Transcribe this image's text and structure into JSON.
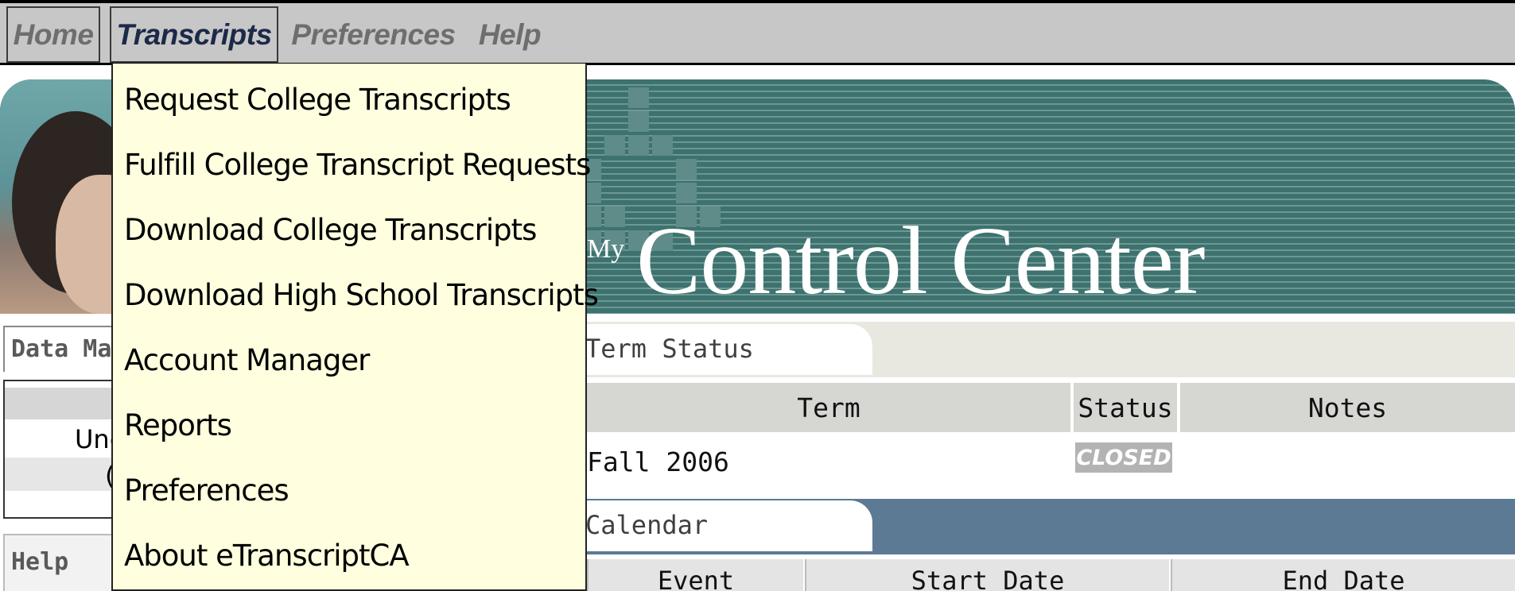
{
  "menubar": {
    "items": [
      {
        "label": "Home"
      },
      {
        "label": "Transcripts"
      },
      {
        "label": "Preferences"
      },
      {
        "label": "Help"
      }
    ]
  },
  "dropdown": {
    "items": [
      {
        "label": "Request College Transcripts"
      },
      {
        "label": "Fulfill College Transcript Requests"
      },
      {
        "label": "Download College Transcripts"
      },
      {
        "label": "Download High School Transcripts"
      },
      {
        "label": "Account Manager"
      },
      {
        "label": "Reports"
      },
      {
        "label": "Preferences"
      },
      {
        "label": "About eTranscriptCA"
      }
    ]
  },
  "banner": {
    "prefix": "My",
    "title": "Control Center"
  },
  "left": {
    "panel_title": "Data Ma",
    "row2_text": "Unc",
    "row3_text": "(",
    "help_title": "Help"
  },
  "term_status": {
    "tab_title": "Term Status",
    "columns": {
      "term": "Term",
      "status": "Status",
      "notes": "Notes"
    },
    "rows": [
      {
        "term": "Fall 2006",
        "status": "CLOSED",
        "notes": ""
      }
    ]
  },
  "calendar": {
    "tab_title": "Calendar",
    "columns": {
      "event": "Event",
      "start": "Start Date",
      "end": "End Date"
    }
  },
  "colors": {
    "menubar_bg": "#c7c7c7",
    "dropdown_bg": "#ffffdf",
    "banner_teal": "#3a6e6b",
    "calendar_band": "#5c7a93",
    "active_menu_text": "#1c2a48"
  }
}
